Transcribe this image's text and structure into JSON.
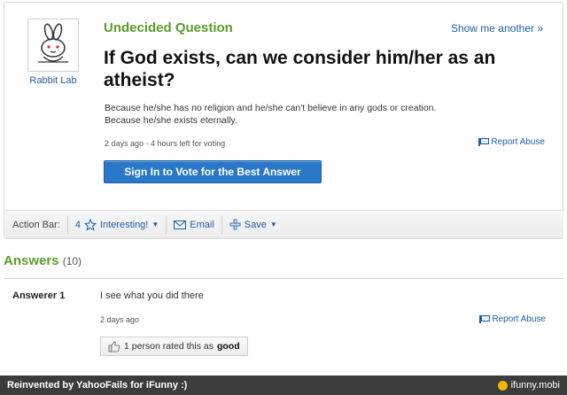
{
  "question": {
    "status": "Undecided Question",
    "show_more": "Show me another »",
    "title": "If God exists, can we consider him/her as an atheist?",
    "body_line1": "Because he/she has no religion and he/she can't believe in any gods or creation.",
    "body_line2": "Because he/she exists eternally.",
    "meta": "2 days ago - 4 hours left for voting",
    "report": "Report Abuse",
    "sign_in": "Sign In to Vote for the Best Answer",
    "asker": "Rabbit Lab"
  },
  "action_bar": {
    "label": "Action Bar:",
    "interesting_count": "4",
    "interesting": "Interesting!",
    "email": "Email",
    "save": "Save"
  },
  "answers": {
    "heading": "Answers",
    "count": "(10)",
    "items": [
      {
        "author": "Answerer 1",
        "text": "I see what you did there",
        "meta": "2 days ago",
        "report": "Report Abuse",
        "rated_prefix": "1 person rated this as",
        "rated_value": "good"
      }
    ]
  },
  "footer": {
    "left": "Reinvented by YahooFails for iFunny :)",
    "right": "ifunny.mobi"
  },
  "colors": {
    "green": "#5a9d2b",
    "link": "#1b5fa8",
    "button": "#2a79c8",
    "footer": "#3c3c3c"
  }
}
